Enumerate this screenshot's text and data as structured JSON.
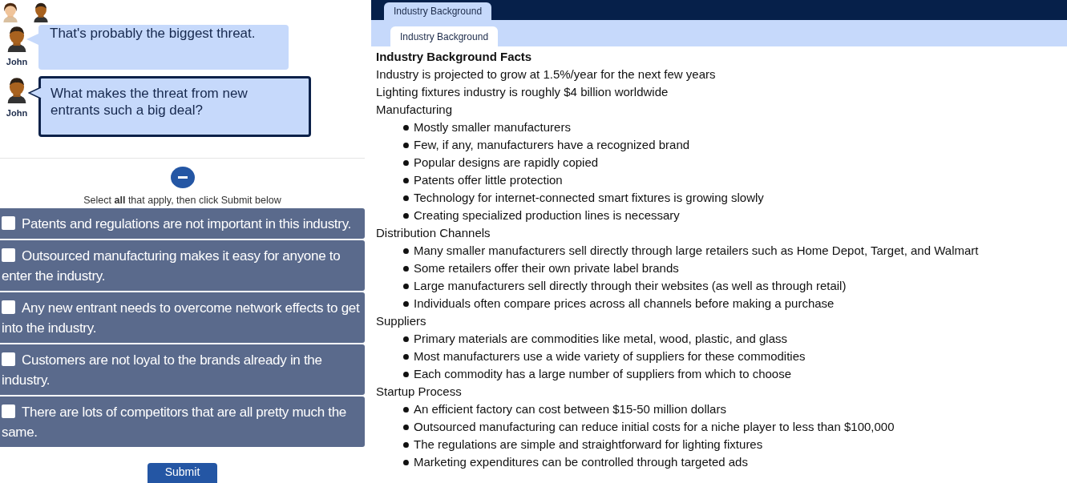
{
  "top_avatars": [
    {
      "kind": "female"
    },
    {
      "kind": "male"
    }
  ],
  "chat": [
    {
      "speaker": "John",
      "text": "That's probably the biggest threat.",
      "current": false
    },
    {
      "speaker": "John",
      "text": "What makes the threat from new entrants such a big deal?",
      "current": true
    }
  ],
  "collapse_button": {
    "expanded": true
  },
  "instruction": "Select **all** that apply, then click Submit below",
  "options": [
    {
      "label": "Patents and regulations are not important in this industry.",
      "checked": false
    },
    {
      "label": "Outsourced manufacturing makes it easy for anyone to enter the industry.",
      "checked": false
    },
    {
      "label": "Any new entrant needs to overcome network effects to get into the industry.",
      "checked": false
    },
    {
      "label": "Customers are not loyal to the brands already in the industry.",
      "checked": false
    },
    {
      "label": "There are lots of competitors that are all pretty much the same.",
      "checked": false
    }
  ],
  "submit_button": "Submit",
  "tabs": [
    {
      "label": "Industry Background",
      "selected": true
    }
  ],
  "subtabs": [
    {
      "label": "Industry Background",
      "selected": true
    }
  ],
  "content": {
    "title": "Industry Background Facts",
    "lines": [
      "Industry is projected to grow at 1.5%/year for the next few years",
      "Lighting fixtures industry is roughly $4 billion worldwide"
    ],
    "sections": [
      {
        "heading": "Manufacturing",
        "bullets": [
          "Mostly smaller manufacturers",
          "Few, if any, manufacturers have a recognized brand",
          "Popular designs are rapidly copied",
          "Patents offer little protection",
          "Technology for internet-connected smart fixtures is growing slowly",
          "Creating specialized production lines is necessary"
        ]
      },
      {
        "heading": "Distribution Channels",
        "bullets": [
          "Many smaller manufacturers sell directly through large retailers such as Home Depot, Target, and Walmart",
          "Some retailers offer their own private label brands",
          "Large manufacturers sell directly through their websites (as well as through retail)",
          "Individuals often compare prices across all channels before making a purchase"
        ]
      },
      {
        "heading": "Suppliers",
        "bullets": [
          "Primary materials are commodities like metal, wood, plastic, and glass",
          "Most manufacturers use a wide variety of suppliers for these commodities",
          "Each commodity has a large number of suppliers from which to choose"
        ]
      },
      {
        "heading": "Startup Process",
        "bullets": [
          "An efficient factory can cost between $15-50 million dollars",
          "Outsourced manufacturing can reduce initial costs for a niche player to less than $100,000",
          "The regulations are simple and straightforward for lighting fixtures",
          "Marketing expenditures can be controlled through targeted ads"
        ]
      }
    ]
  }
}
